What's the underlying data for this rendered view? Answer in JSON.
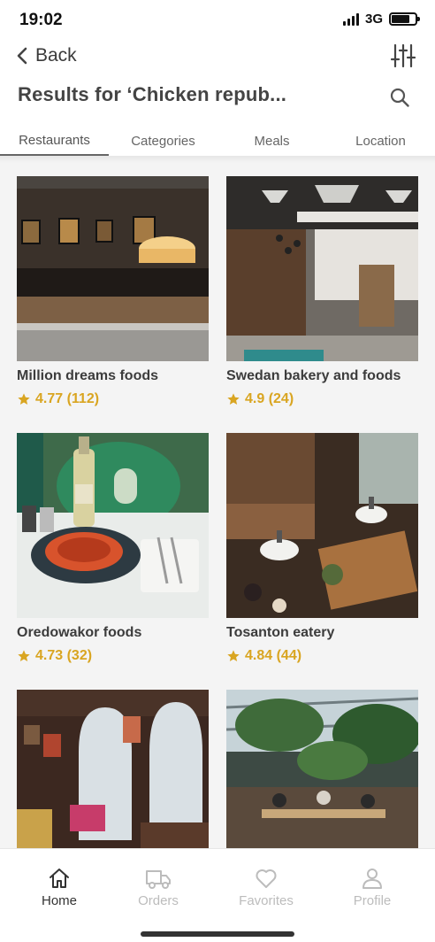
{
  "status": {
    "time": "19:02",
    "network": "3G"
  },
  "header": {
    "back_label": "Back",
    "title": "Results for ‘Chicken repub..."
  },
  "tabs": [
    {
      "label": "Restaurants",
      "active": true
    },
    {
      "label": "Categories",
      "active": false
    },
    {
      "label": "Meals",
      "active": false
    },
    {
      "label": "Location",
      "active": false
    }
  ],
  "restaurants": [
    {
      "name": "Million dreams foods",
      "rating": "4.77 (112)"
    },
    {
      "name": "Swedan bakery and foods",
      "rating": "4.9 (24)"
    },
    {
      "name": "Oredowakor foods",
      "rating": "4.73 (32)"
    },
    {
      "name": "Tosanton eatery",
      "rating": "4.84 (44)"
    },
    {
      "name": "",
      "rating": ""
    },
    {
      "name": "",
      "rating": ""
    }
  ],
  "nav": [
    {
      "label": "Home",
      "icon": "home-icon",
      "active": true
    },
    {
      "label": "Orders",
      "icon": "truck-icon",
      "active": false
    },
    {
      "label": "Favorites",
      "icon": "heart-icon",
      "active": false
    },
    {
      "label": "Profile",
      "icon": "user-icon",
      "active": false
    }
  ],
  "colors": {
    "accent": "#d9a521",
    "text": "#3a3a3a",
    "inactive": "#bcbcbc"
  }
}
